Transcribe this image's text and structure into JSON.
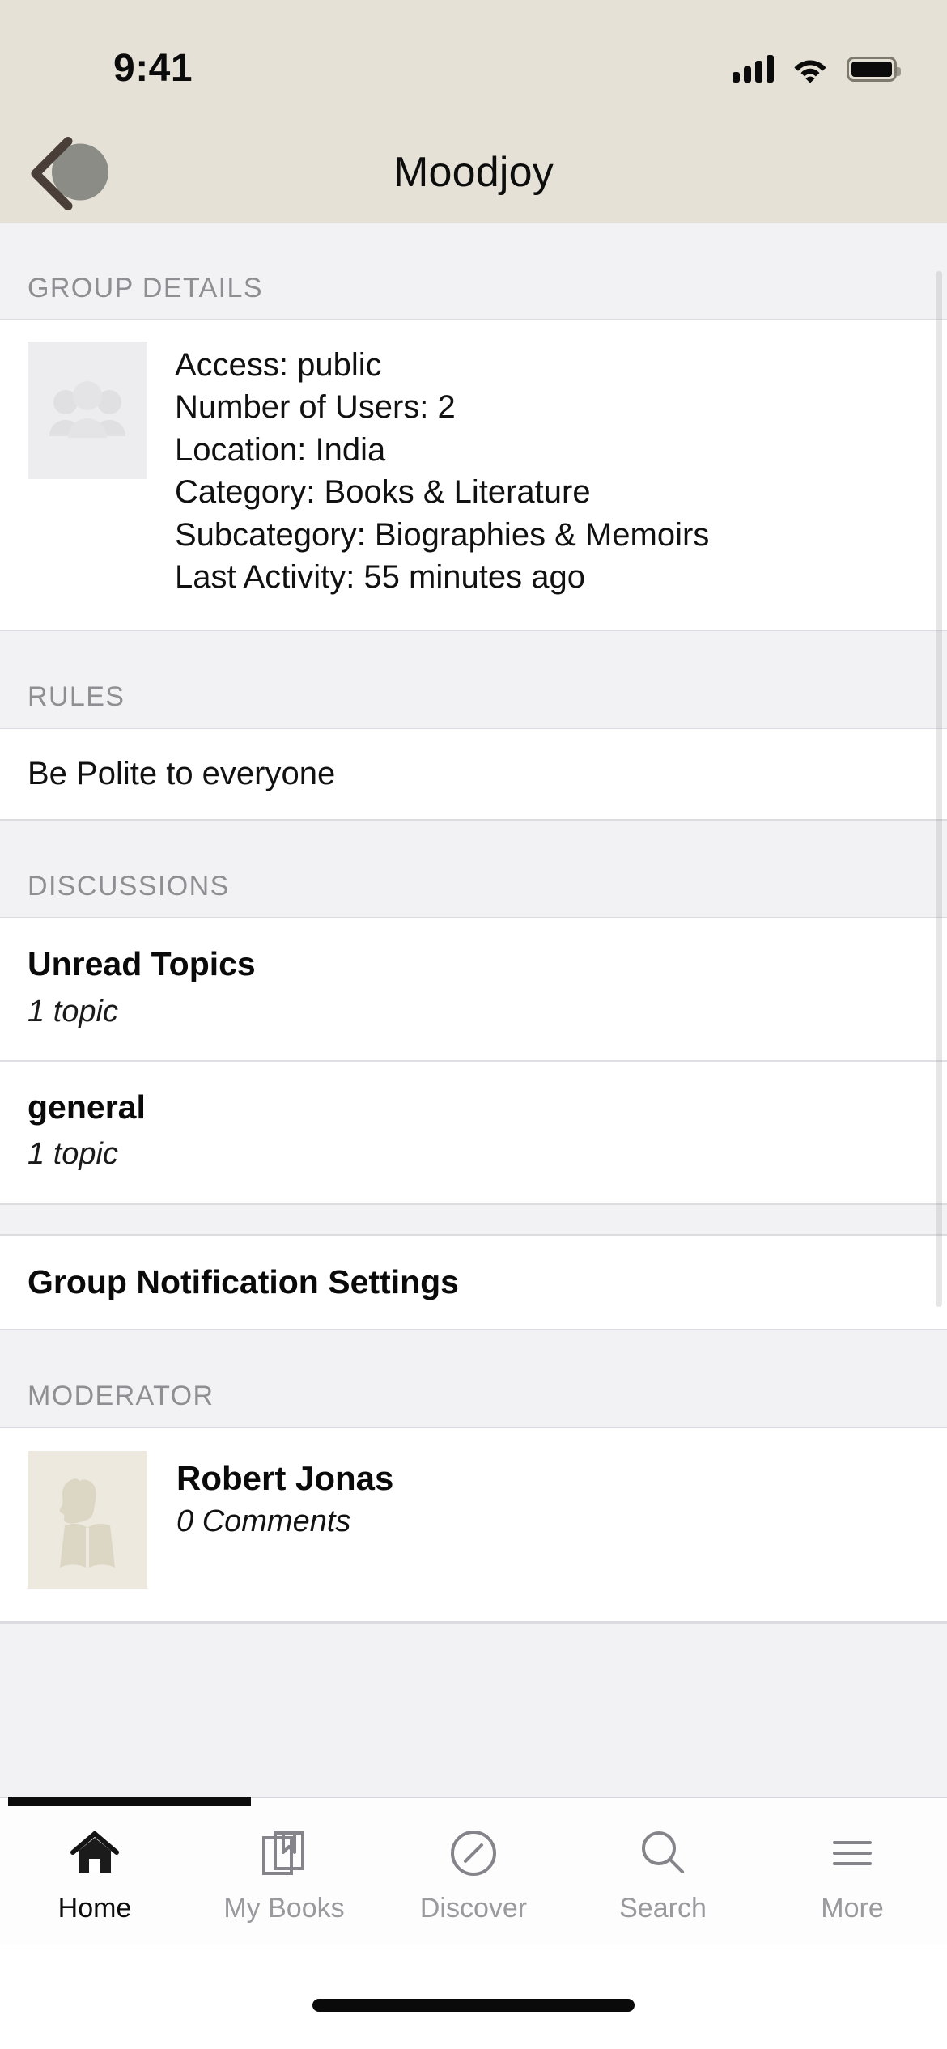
{
  "status_bar": {
    "time": "9:41",
    "icons": [
      "cellular-signal-icon",
      "wifi-icon",
      "battery-icon"
    ]
  },
  "nav_bar": {
    "title": "Moodjoy",
    "back_icon": "chevron-left-icon"
  },
  "sections": {
    "group_details": {
      "header": "GROUP DETAILS",
      "thumbnail_icon": "group-people-placeholder-icon",
      "lines": [
        "Access: public",
        "Number of Users: 2",
        "Location: India",
        "Category: Books & Literature",
        "Subcategory: Biographies & Memoirs",
        "Last Activity: 55 minutes ago"
      ]
    },
    "rules": {
      "header": "RULES",
      "items": [
        "Be Polite to everyone"
      ]
    },
    "discussions": {
      "header": "DISCUSSIONS",
      "items": [
        {
          "title": "Unread Topics",
          "subtitle": "1 topic"
        },
        {
          "title": "general",
          "subtitle": "1 topic"
        }
      ]
    },
    "notifications": {
      "label": "Group Notification Settings"
    },
    "moderator": {
      "header": "MODERATOR",
      "avatar_icon": "person-reading-book-avatar",
      "name": "Robert Jonas",
      "comments": "0 Comments"
    }
  },
  "tab_bar": {
    "tabs": [
      {
        "label": "Home",
        "icon": "home-icon",
        "active": true
      },
      {
        "label": "My Books",
        "icon": "books-bookmark-icon",
        "active": false
      },
      {
        "label": "Discover",
        "icon": "compass-icon",
        "active": false
      },
      {
        "label": "Search",
        "icon": "magnifier-icon",
        "active": false
      },
      {
        "label": "More",
        "icon": "hamburger-menu-icon",
        "active": false
      }
    ]
  },
  "colors": {
    "header_bg": "#E5E1D6",
    "section_bg": "#F2F1F4",
    "card_bg": "#FFFFFF",
    "section_label": "#8E8E93",
    "text_primary": "#111111",
    "tab_inactive": "#9A9A9E",
    "tab_active": "#0C0C0C",
    "avatar_bg": "#EDE9DE"
  }
}
